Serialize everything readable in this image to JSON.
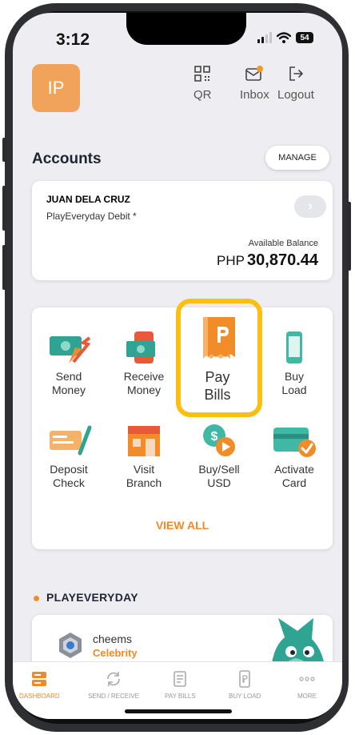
{
  "status_bar": {
    "time": "3:12",
    "battery": "54"
  },
  "header": {
    "avatar_initials": "IP",
    "qr_label": "QR",
    "inbox_label": "Inbox",
    "logout_label": "Logout"
  },
  "accounts": {
    "title": "Accounts",
    "manage_label": "MANAGE",
    "card": {
      "name": "JUAN DELA CRUZ",
      "type": "PlayEveryday Debit *",
      "balance_label": "Available Balance",
      "currency": "PHP",
      "balance": "30,870.44"
    }
  },
  "services": {
    "row1": [
      {
        "line1": "Send",
        "line2": "Money",
        "icon": "cash-send-icon"
      },
      {
        "line1": "Receive",
        "line2": "Money",
        "icon": "phone-cash-icon"
      },
      {
        "line1": "Pay",
        "line2": "Bills",
        "icon": "bill-icon"
      },
      {
        "line1": "Buy",
        "line2": "Load",
        "icon": "mobile-icon"
      }
    ],
    "row2": [
      {
        "line1": "Deposit",
        "line2": "Check",
        "icon": "check-pen-icon"
      },
      {
        "line1": "Visit",
        "line2": "Branch",
        "icon": "bank-branch-icon"
      },
      {
        "line1": "Buy/Sell",
        "line2": "USD",
        "icon": "usd-coin-icon"
      },
      {
        "line1": "Activate",
        "line2": "Card",
        "icon": "card-check-icon"
      }
    ],
    "view_all_label": "VIEW ALL"
  },
  "playeveryday": {
    "title": "PLAYEVERYDAY",
    "user_name": "cheems",
    "tier": "Celebrity"
  },
  "nav": {
    "dashboard": "DASHBOARD",
    "send_receive": "SEND / RECEIVE",
    "pay_bills": "PAY BILLS",
    "buy_load": "BUY LOAD",
    "more": "MORE"
  },
  "colors": {
    "accent_orange": "#f08a2a",
    "highlight_yellow": "#fbbf12",
    "avatar_bg": "#f2a35a",
    "teal": "#3fb8a6",
    "notification_dot": "#f39c23"
  }
}
